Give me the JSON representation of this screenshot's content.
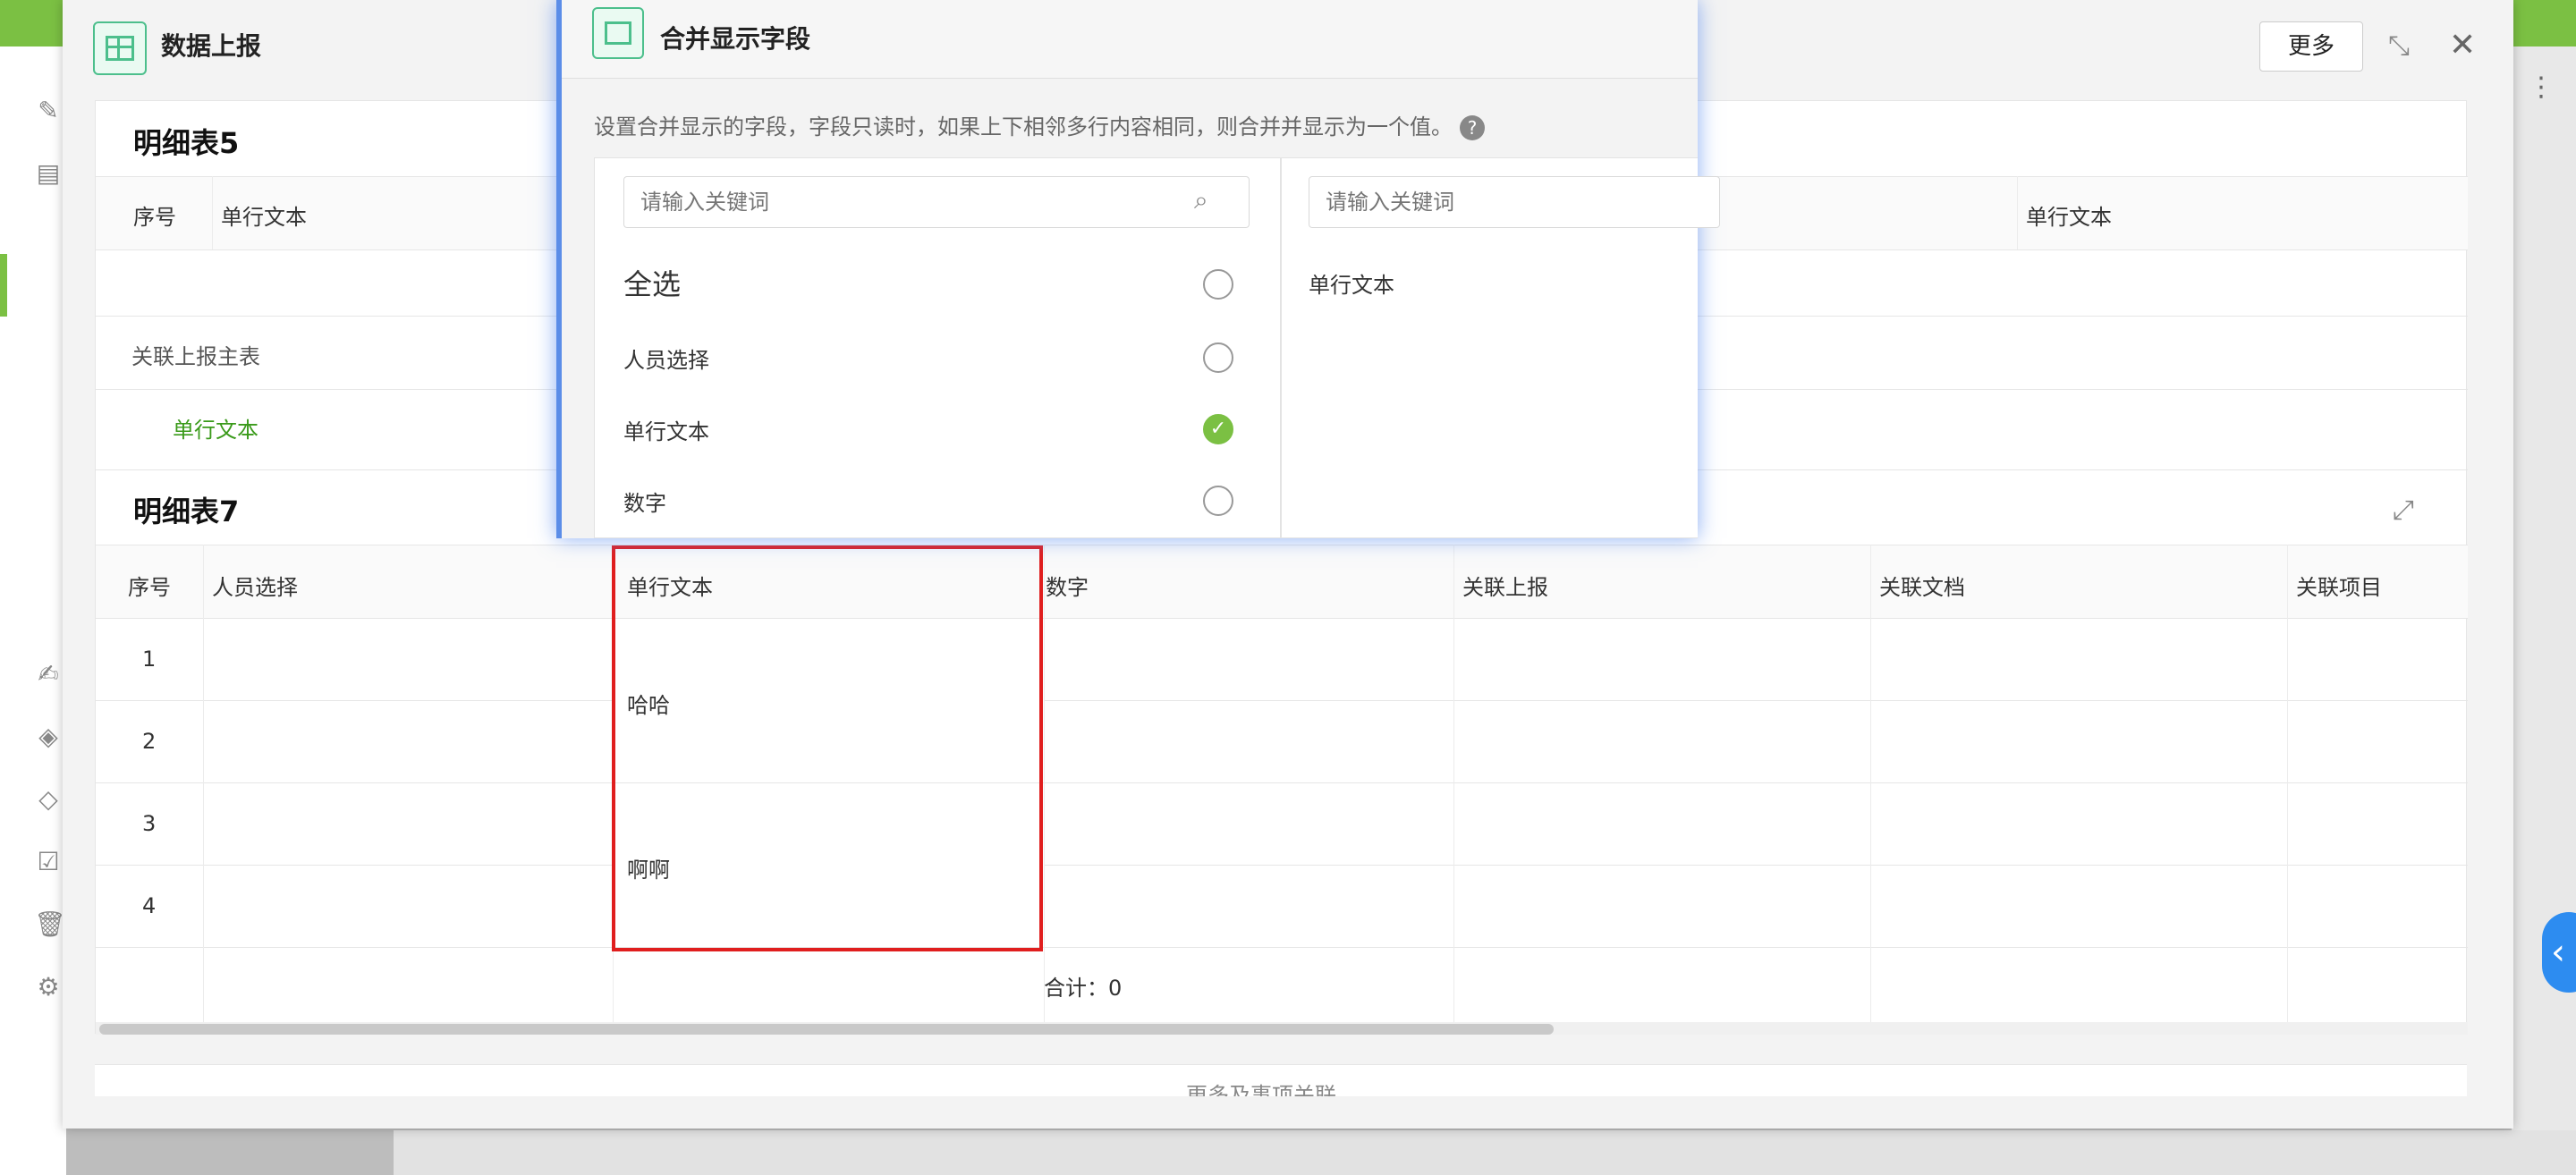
{
  "main_dialog": {
    "title": "数据上报",
    "more_label": "更多",
    "shrink_icon": "shrink-icon",
    "close_icon": "close-icon"
  },
  "detail5": {
    "title": "明细表5",
    "headers": [
      "序号",
      "单行文本",
      "单行文本"
    ],
    "related_label": "关联上报主表",
    "related_value": "单行文本"
  },
  "detail7": {
    "title": "明细表7",
    "headers": [
      "序号",
      "人员选择",
      "单行文本",
      "数字",
      "关联上报",
      "关联文档",
      "关联项目"
    ],
    "rows": [
      "1",
      "2",
      "3",
      "4"
    ],
    "merged_values": [
      "哈哈",
      "啊啊"
    ],
    "total": "合计：0",
    "expand_icon": "expand-icon"
  },
  "more_related": "更多及事项关联",
  "popup": {
    "title": "合并显示字段",
    "description": "设置合并显示的字段，字段只读时，如果上下相邻多行内容相同，则合并并显示为一个值。",
    "help_label": "?",
    "search_placeholder_left": "请输入关键词",
    "search_placeholder_right": "请输入关键词",
    "select_all": "全选",
    "options": [
      {
        "label": "人员选择",
        "checked": false
      },
      {
        "label": "单行文本",
        "checked": true
      },
      {
        "label": "数字",
        "checked": false
      }
    ],
    "selected": [
      "单行文本"
    ],
    "check_mark": "✓"
  },
  "colors": {
    "accent": "#7bc043",
    "highlight": "#e01e1e",
    "popup_glow": "#5b8de8"
  }
}
